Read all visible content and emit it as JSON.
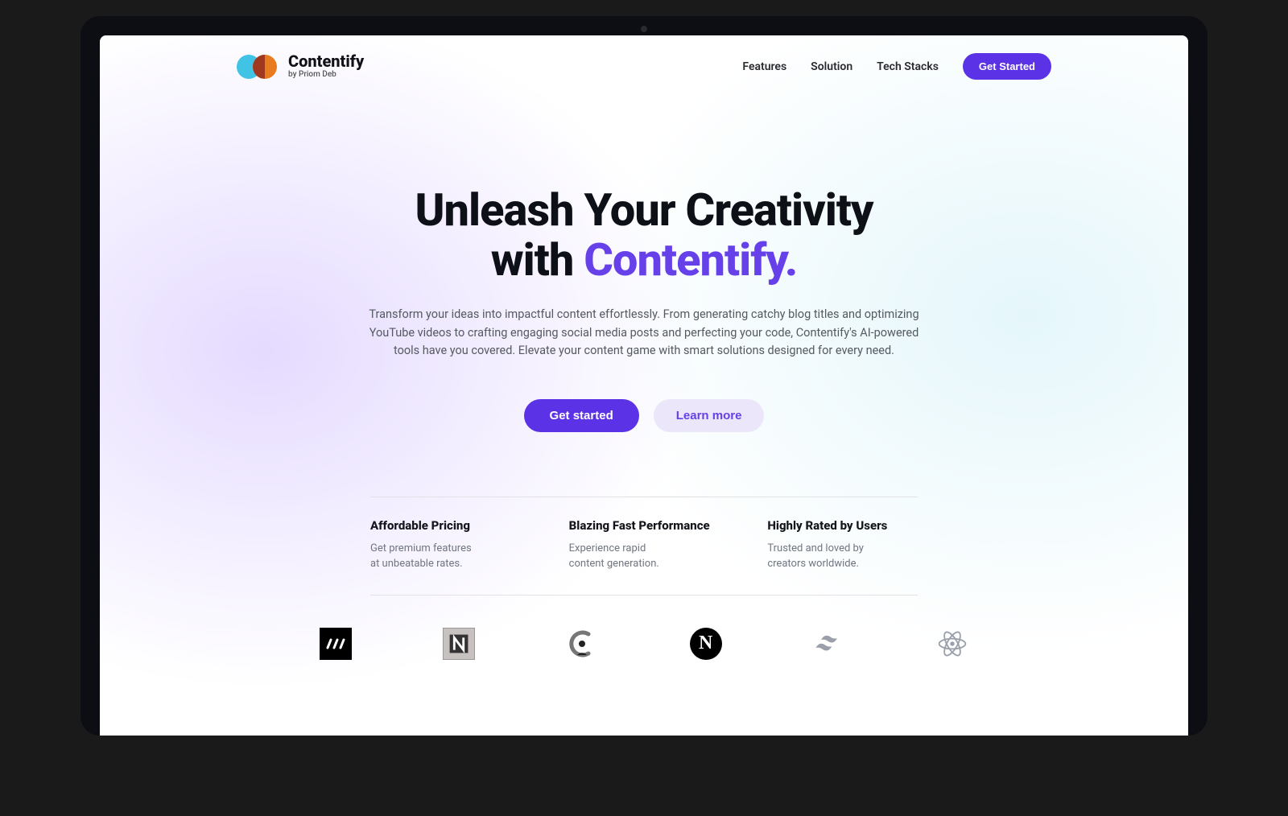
{
  "header": {
    "logo_title": "Contentify",
    "logo_subtitle": "by Priom Deb",
    "nav": {
      "features": "Features",
      "solution": "Solution",
      "tech_stacks": "Tech Stacks"
    },
    "cta": "Get Started"
  },
  "hero": {
    "title_line1": "Unleash Your Creativity",
    "title_line2_prefix": "with ",
    "title_line2_accent": "Contentify.",
    "description": "Transform your ideas into impactful content effortlessly. From generating catchy blog titles and optimizing YouTube videos to crafting engaging social media posts and perfecting your code, Contentify's AI-powered tools have you covered. Elevate your content game with smart solutions designed for every need.",
    "primary_btn": "Get started",
    "secondary_btn": "Learn more"
  },
  "features": [
    {
      "title": "Affordable Pricing",
      "desc_l1": "Get premium features",
      "desc_l2": "at unbeatable rates."
    },
    {
      "title": "Blazing Fast Performance",
      "desc_l1": "Experience rapid",
      "desc_l2": "content generation."
    },
    {
      "title": "Highly Rated by Users",
      "desc_l1": "Trusted and loved by",
      "desc_l2": "creators worldwide."
    }
  ],
  "tech_logos": [
    "moralis-icon",
    "nhost-icon",
    "clerk-icon",
    "nextjs-icon",
    "tailwind-icon",
    "react-icon"
  ],
  "colors": {
    "accent": "#6640e8",
    "accent_bg_soft": "#ece6fb",
    "text_heading": "#0e1018",
    "text_body": "#555a60"
  }
}
